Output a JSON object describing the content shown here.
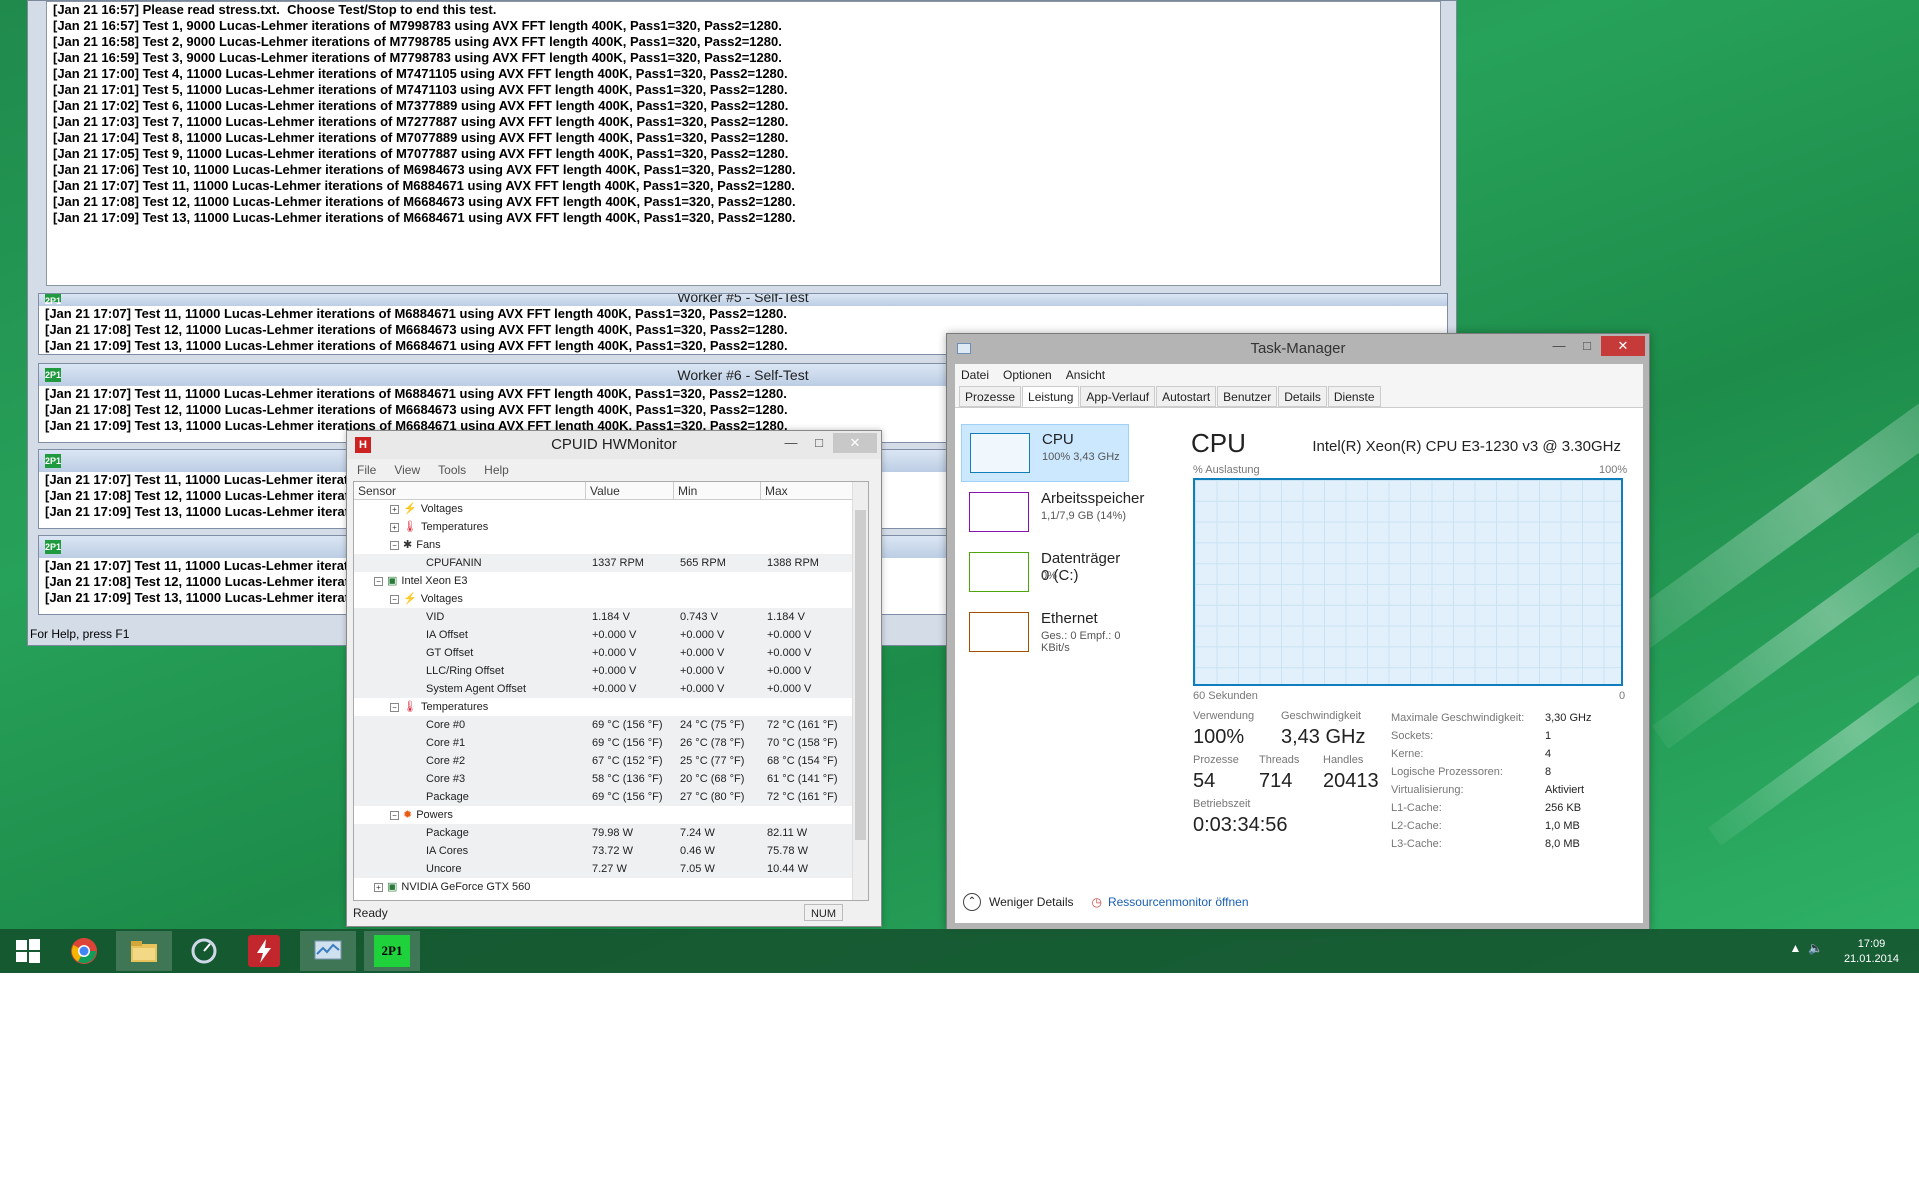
{
  "prime95": {
    "main_log": [
      "[Jan 21 16:57] Please read stress.txt.  Choose Test/Stop to end this test.",
      "[Jan 21 16:57] Test 1, 9000 Lucas-Lehmer iterations of M7998783 using AVX FFT length 400K, Pass1=320, Pass2=1280.",
      "[Jan 21 16:58] Test 2, 9000 Lucas-Lehmer iterations of M7798785 using AVX FFT length 400K, Pass1=320, Pass2=1280.",
      "[Jan 21 16:59] Test 3, 9000 Lucas-Lehmer iterations of M7798783 using AVX FFT length 400K, Pass1=320, Pass2=1280.",
      "[Jan 21 17:00] Test 4, 11000 Lucas-Lehmer iterations of M7471105 using AVX FFT length 400K, Pass1=320, Pass2=1280.",
      "[Jan 21 17:01] Test 5, 11000 Lucas-Lehmer iterations of M7471103 using AVX FFT length 400K, Pass1=320, Pass2=1280.",
      "[Jan 21 17:02] Test 6, 11000 Lucas-Lehmer iterations of M7377889 using AVX FFT length 400K, Pass1=320, Pass2=1280.",
      "[Jan 21 17:03] Test 7, 11000 Lucas-Lehmer iterations of M7277887 using AVX FFT length 400K, Pass1=320, Pass2=1280.",
      "[Jan 21 17:04] Test 8, 11000 Lucas-Lehmer iterations of M7077889 using AVX FFT length 400K, Pass1=320, Pass2=1280.",
      "[Jan 21 17:05] Test 9, 11000 Lucas-Lehmer iterations of M7077887 using AVX FFT length 400K, Pass1=320, Pass2=1280.",
      "[Jan 21 17:06] Test 10, 11000 Lucas-Lehmer iterations of M6984673 using AVX FFT length 400K, Pass1=320, Pass2=1280.",
      "[Jan 21 17:07] Test 11, 11000 Lucas-Lehmer iterations of M6884671 using AVX FFT length 400K, Pass1=320, Pass2=1280.",
      "[Jan 21 17:08] Test 12, 11000 Lucas-Lehmer iterations of M6684673 using AVX FFT length 400K, Pass1=320, Pass2=1280.",
      "[Jan 21 17:09] Test 13, 11000 Lucas-Lehmer iterations of M6684671 using AVX FFT length 400K, Pass1=320, Pass2=1280."
    ],
    "worker5_title": "Worker #5 - Self-Test",
    "worker6_title": "Worker #6 - Self-Test",
    "worker_lines": [
      "[Jan 21 17:07] Test 11, 11000 Lucas-Lehmer iterations of M6884671 using AVX FFT length 400K, Pass1=320, Pass2=1280.",
      "[Jan 21 17:08] Test 12, 11000 Lucas-Lehmer iterations of M6684673 using AVX FFT length 400K, Pass1=320, Pass2=1280.",
      "[Jan 21 17:09] Test 13, 11000 Lucas-Lehmer iterations of M6684671 using AVX FFT length 400K, Pass1=320, Pass2=1280."
    ],
    "status": "For Help, press F1"
  },
  "hwmonitor": {
    "title": "CPUID HWMonitor",
    "menu": [
      "File",
      "View",
      "Tools",
      "Help"
    ],
    "columns": [
      "Sensor",
      "Value",
      "Min",
      "Max"
    ],
    "rows": [
      {
        "indent": 2,
        "toggle": "+",
        "icon": "volt",
        "name": "Voltages",
        "v": "",
        "min": "",
        "max": ""
      },
      {
        "indent": 2,
        "toggle": "+",
        "icon": "temp",
        "name": "Temperatures",
        "v": "",
        "min": "",
        "max": ""
      },
      {
        "indent": 2,
        "toggle": "-",
        "icon": "fan",
        "name": "Fans",
        "v": "",
        "min": "",
        "max": ""
      },
      {
        "indent": 3,
        "toggle": "",
        "icon": "",
        "name": "CPUFANIN",
        "v": "1337 RPM",
        "min": "565 RPM",
        "max": "1388 RPM"
      },
      {
        "indent": 1,
        "toggle": "-",
        "icon": "chip",
        "name": "Intel Xeon E3",
        "v": "",
        "min": "",
        "max": ""
      },
      {
        "indent": 2,
        "toggle": "-",
        "icon": "volt",
        "name": "Voltages",
        "v": "",
        "min": "",
        "max": ""
      },
      {
        "indent": 3,
        "toggle": "",
        "icon": "",
        "name": "VID",
        "v": "1.184 V",
        "min": "0.743 V",
        "max": "1.184 V"
      },
      {
        "indent": 3,
        "toggle": "",
        "icon": "",
        "name": "IA Offset",
        "v": "+0.000 V",
        "min": "+0.000 V",
        "max": "+0.000 V"
      },
      {
        "indent": 3,
        "toggle": "",
        "icon": "",
        "name": "GT Offset",
        "v": "+0.000 V",
        "min": "+0.000 V",
        "max": "+0.000 V"
      },
      {
        "indent": 3,
        "toggle": "",
        "icon": "",
        "name": "LLC/Ring Offset",
        "v": "+0.000 V",
        "min": "+0.000 V",
        "max": "+0.000 V"
      },
      {
        "indent": 3,
        "toggle": "",
        "icon": "",
        "name": "System Agent Offset",
        "v": "+0.000 V",
        "min": "+0.000 V",
        "max": "+0.000 V"
      },
      {
        "indent": 2,
        "toggle": "-",
        "icon": "temp",
        "name": "Temperatures",
        "v": "",
        "min": "",
        "max": ""
      },
      {
        "indent": 3,
        "toggle": "",
        "icon": "",
        "name": "Core #0",
        "v": "69 °C  (156 °F)",
        "min": "24 °C  (75 °F)",
        "max": "72 °C  (161 °F)"
      },
      {
        "indent": 3,
        "toggle": "",
        "icon": "",
        "name": "Core #1",
        "v": "69 °C  (156 °F)",
        "min": "26 °C  (78 °F)",
        "max": "70 °C  (158 °F)"
      },
      {
        "indent": 3,
        "toggle": "",
        "icon": "",
        "name": "Core #2",
        "v": "67 °C  (152 °F)",
        "min": "25 °C  (77 °F)",
        "max": "68 °C  (154 °F)"
      },
      {
        "indent": 3,
        "toggle": "",
        "icon": "",
        "name": "Core #3",
        "v": "58 °C  (136 °F)",
        "min": "20 °C  (68 °F)",
        "max": "61 °C  (141 °F)"
      },
      {
        "indent": 3,
        "toggle": "",
        "icon": "",
        "name": "Package",
        "v": "69 °C  (156 °F)",
        "min": "27 °C  (80 °F)",
        "max": "72 °C  (161 °F)"
      },
      {
        "indent": 2,
        "toggle": "-",
        "icon": "power",
        "name": "Powers",
        "v": "",
        "min": "",
        "max": ""
      },
      {
        "indent": 3,
        "toggle": "",
        "icon": "",
        "name": "Package",
        "v": "79.98 W",
        "min": "7.24 W",
        "max": "82.11 W"
      },
      {
        "indent": 3,
        "toggle": "",
        "icon": "",
        "name": "IA Cores",
        "v": "73.72 W",
        "min": "0.46 W",
        "max": "75.78 W"
      },
      {
        "indent": 3,
        "toggle": "",
        "icon": "",
        "name": "Uncore",
        "v": "7.27 W",
        "min": "7.05 W",
        "max": "10.44 W"
      },
      {
        "indent": 1,
        "toggle": "+",
        "icon": "chip",
        "name": "NVIDIA GeForce GTX 560",
        "v": "",
        "min": "",
        "max": ""
      }
    ],
    "status": "Ready",
    "num": "NUM"
  },
  "taskmanager": {
    "title": "Task-Manager",
    "menu": [
      "Datei",
      "Optionen",
      "Ansicht"
    ],
    "tabs": [
      "Prozesse",
      "Leistung",
      "App-Verlauf",
      "Autostart",
      "Benutzer",
      "Details",
      "Dienste"
    ],
    "active_tab": "Leistung",
    "resources": [
      {
        "name": "CPU",
        "sub": "100% 3,43 GHz",
        "color": "#117dbb"
      },
      {
        "name": "Arbeitsspeicher",
        "sub": "1,1/7,9 GB (14%)",
        "color": "#8b12ae"
      },
      {
        "name": "Datenträger 0 (C:)",
        "sub": "0%",
        "color": "#4da60c"
      },
      {
        "name": "Ethernet",
        "sub": "Ges.: 0 Empf.: 0 KBit/s",
        "color": "#a74f01"
      }
    ],
    "cpu_header": "CPU",
    "cpu_model": "Intel(R) Xeon(R) CPU E3-1230 v3 @ 3.30GHz",
    "graph_label": "% Auslastung",
    "graph_max": "100%",
    "graph_time": "60 Sekunden",
    "graph_zero": "0",
    "utilization_pct": 100,
    "stats": {
      "usage_lbl": "Verwendung",
      "usage": "100%",
      "speed_lbl": "Geschwindigkeit",
      "speed": "3,43 GHz",
      "proc_lbl": "Prozesse",
      "proc": "54",
      "threads_lbl": "Threads",
      "threads": "714",
      "handles_lbl": "Handles",
      "handles": "20413",
      "uptime_lbl": "Betriebszeit",
      "uptime": "0:03:34:56"
    },
    "details": [
      [
        "Maximale Geschwindigkeit:",
        "3,30 GHz"
      ],
      [
        "Sockets:",
        "1"
      ],
      [
        "Kerne:",
        "4"
      ],
      [
        "Logische Prozessoren:",
        "8"
      ],
      [
        "Virtualisierung:",
        "Aktiviert"
      ],
      [
        "L1-Cache:",
        "256 KB"
      ],
      [
        "L2-Cache:",
        "1,0 MB"
      ],
      [
        "L3-Cache:",
        "8,0 MB"
      ]
    ],
    "fewer_details": "Weniger Details",
    "resmon": "Ressourcenmonitor öffnen"
  },
  "taskbar": {
    "time": "17:09",
    "date": "21.01.2014"
  }
}
